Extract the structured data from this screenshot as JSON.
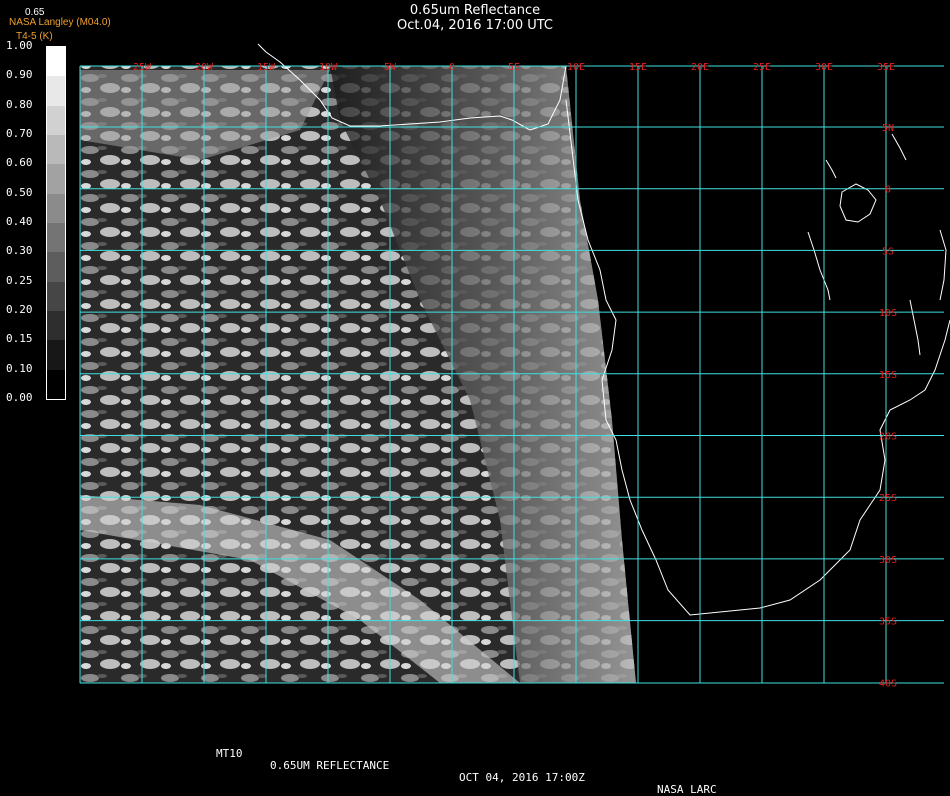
{
  "title": "0.65um Reflectance",
  "timestamp": "Oct.04, 2016 17:00 UTC",
  "credit": "NASA Langley (M04.0)",
  "channel_label": "T4-5 (K)",
  "colorbar": {
    "top_label": "0.65",
    "ticks": [
      "1.00",
      "0.90",
      "0.80",
      "0.70",
      "0.60",
      "0.50",
      "0.40",
      "0.30",
      "0.25",
      "0.20",
      "0.15",
      "0.10",
      "0.00"
    ]
  },
  "grid": {
    "longitude_labels": [
      "25W",
      "20W",
      "15W",
      "10W",
      "5W",
      "0",
      "5E",
      "10E",
      "15E",
      "20E",
      "25E",
      "30E",
      "35E"
    ],
    "latitude_labels": [
      "5N",
      "0",
      "5S",
      "10S",
      "15S",
      "20S",
      "25S",
      "30S",
      "35S",
      "40S"
    ],
    "grid_color": "#40e0e0",
    "label_color": "#e02020"
  },
  "footer": {
    "product": "MT10",
    "field": "0.65UM REFLECTANCE",
    "datetime": "OCT 04, 2016 17:00Z",
    "source": "NASA LARC"
  }
}
